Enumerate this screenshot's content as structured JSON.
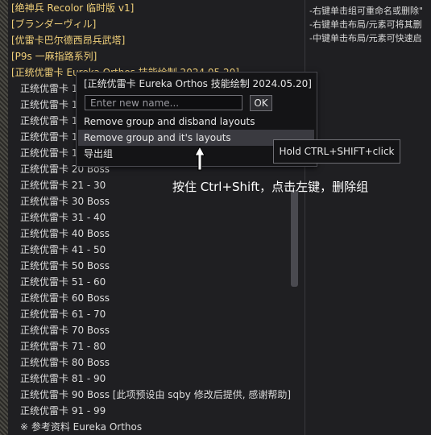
{
  "group_headers": [
    "[绝神兵 Recolor 临时版 v1]",
    "[ブランダーヴィル]",
    "[优雷卡巴尔德西昂兵武塔]",
    "[P9s 一麻指路系列]",
    "[正统优雷卡 Eureka Orthos 技能绘制 2024.05.20]"
  ],
  "layout_items": [
    "正统优雷卡 1 - 10",
    "正统优雷卡 10 Boss",
    "正统优雷卡 11 - 20",
    "正统优雷卡 11 - 20",
    "正统优雷卡 11 - 20",
    "正统优雷卡 20 Boss",
    "正统优雷卡 21 - 30",
    "正统优雷卡 30 Boss",
    "正统优雷卡 31 - 40",
    "正统优雷卡 40 Boss",
    "正统优雷卡 41 - 50",
    "正统优雷卡 50 Boss",
    "正统优雷卡 51 - 60",
    "正统优雷卡 60 Boss",
    "正统优雷卡 61 - 70",
    "正统优雷卡 70 Boss",
    "正统优雷卡 71 - 80",
    "正统优雷卡 80 Boss",
    "正统优雷卡 81 - 90",
    "正统优雷卡 90 Boss [此项预设由 sqby 修改后提供, 感谢帮助]",
    "正统优雷卡 91 - 99",
    "※ 参考资料 Eureka Orthos"
  ],
  "hint_lines": [
    "-右键单击组可重命名或删除\"",
    "-右键单击布局/元素可将其删",
    "-中键单击布局/元素可快速启"
  ],
  "context_menu": {
    "title": "[正统优雷卡 Eureka Orthos 技能绘制 2024.05.20]",
    "rename_placeholder": "Enter new name...",
    "ok_label": "OK",
    "items": [
      "Remove group and disband layouts",
      "Remove group and it's layouts",
      "导出组"
    ]
  },
  "tooltip": "Hold CTRL+SHIFT+click",
  "annotation": "按住 Ctrl+Shift，点击左键，删除组"
}
